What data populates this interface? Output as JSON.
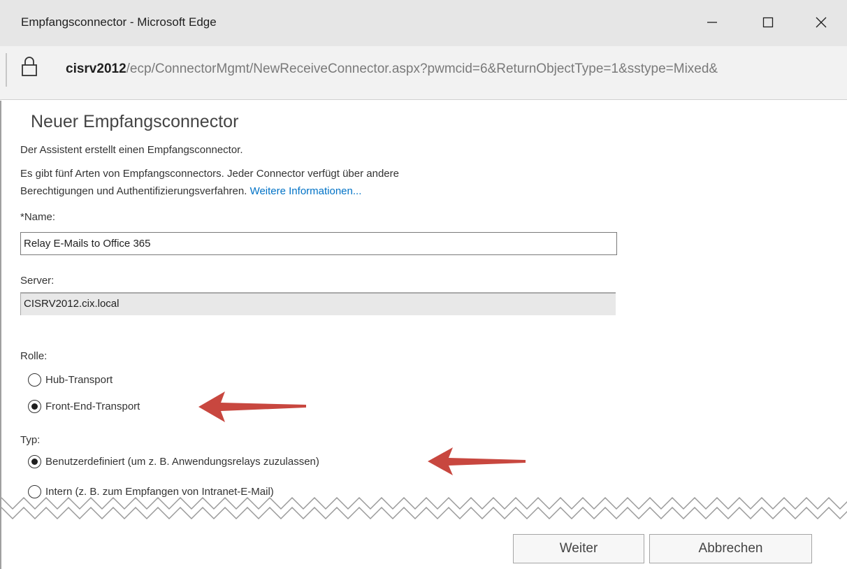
{
  "window": {
    "title": "Empfangsconnector - Microsoft Edge"
  },
  "address": {
    "host": "cisrv2012",
    "path": "/ecp/ConnectorMgmt/NewReceiveConnector.aspx?pwmcid=6&ReturnObjectType=1&sstype=Mixed&"
  },
  "page": {
    "title": "Neuer Empfangsconnector",
    "intro": "Der Assistent erstellt einen Empfangsconnector.",
    "desc_line1": "Es gibt fünf Arten von Empfangsconnectors. Jeder Connector verfügt über andere",
    "desc_line2": "Berechtigungen und Authentifizierungsverfahren.",
    "more_info_link": "Weitere Informationen..."
  },
  "form": {
    "name_label": "*Name:",
    "name_value": "Relay E-Mails to Office 365",
    "server_label": "Server:",
    "server_value": "CISRV2012.cix.local",
    "role_label": "Rolle:",
    "role_options": [
      {
        "label": "Hub-Transport",
        "selected": false
      },
      {
        "label": "Front-End-Transport",
        "selected": true
      }
    ],
    "type_label": "Typ:",
    "type_options": [
      {
        "label": "Benutzerdefiniert (um z. B. Anwendungsrelays zuzulassen)",
        "selected": true
      },
      {
        "label": "Intern (z. B. zum Empfangen von Intranet-E-Mail)",
        "selected": false
      }
    ]
  },
  "buttons": {
    "next": "Weiter",
    "cancel": "Abbrechen"
  },
  "colors": {
    "annotation_arrow": "#c8473f",
    "link": "#0072c6",
    "titlebar": "#e6e6e6"
  }
}
